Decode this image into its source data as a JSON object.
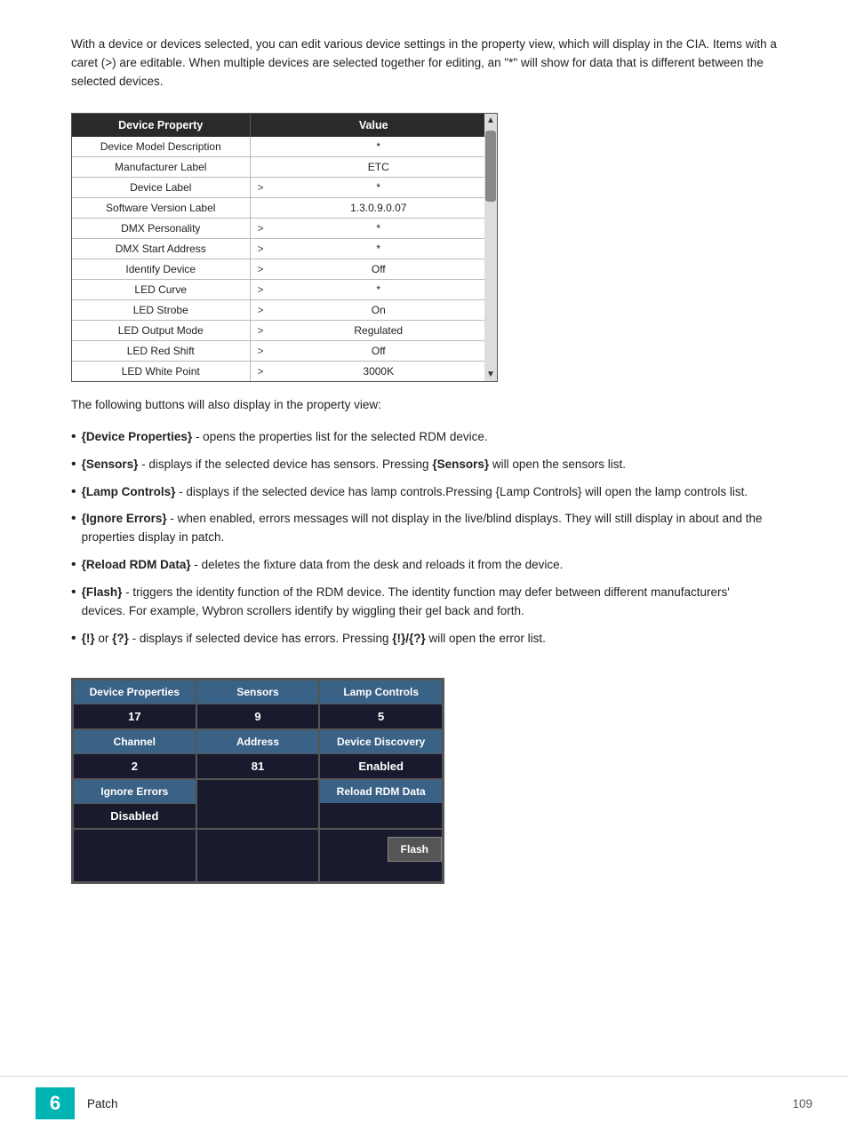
{
  "intro": {
    "text": "With a device or devices selected, you can edit various device settings in the property view, which will display in the CIA. Items with a caret (>) are editable. When multiple devices are selected together for editing, an \"*\" will show for data that is different between the selected devices."
  },
  "property_table": {
    "headers": [
      "Device Property",
      "Value"
    ],
    "rows": [
      {
        "property": "Device Model Description",
        "caret": "",
        "value": "*"
      },
      {
        "property": "Manufacturer Label",
        "caret": "",
        "value": "ETC"
      },
      {
        "property": "Device Label",
        "caret": ">",
        "value": "*"
      },
      {
        "property": "Software Version Label",
        "caret": "",
        "value": "1.3.0.9.0.07"
      },
      {
        "property": "DMX Personality",
        "caret": ">",
        "value": "*"
      },
      {
        "property": "DMX Start Address",
        "caret": ">",
        "value": "*"
      },
      {
        "property": "Identify Device",
        "caret": ">",
        "value": "Off"
      },
      {
        "property": "LED Curve",
        "caret": ">",
        "value": "*"
      },
      {
        "property": "LED Strobe",
        "caret": ">",
        "value": "On"
      },
      {
        "property": "LED Output Mode",
        "caret": ">",
        "value": "Regulated"
      },
      {
        "property": "LED Red Shift",
        "caret": ">",
        "value": "Off"
      },
      {
        "property": "LED White Point",
        "caret": ">",
        "value": "3000K"
      }
    ]
  },
  "bullets_intro": "The following buttons will also display in the property view:",
  "bullets": [
    {
      "key": "{Device Properties}",
      "text": " - opens the properties list for the selected RDM device."
    },
    {
      "key": "{Sensors}",
      "text": " - displays if the selected device has sensors. Pressing "
    },
    {
      "key2": "{Sensors}",
      "text2": " will open the sensors list.",
      "combined": true,
      "full": "{Sensors} - displays if the selected device has sensors. Pressing {Sensors} will open the sensors list."
    },
    {
      "key": "{Lamp Controls}",
      "text": " - displays if the selected device has lamp controls.Pressing {Lamp Controls} will open the lamp controls list.",
      "full": "{Lamp Controls} - displays if the selected device has lamp controls.Pressing {Lamp Controls} will open the lamp controls list."
    },
    {
      "key": "{Ignore Errors}",
      "text": " - when enabled, errors messages will not display in the live/blind displays. They will still display in about and the properties display in patch.",
      "full": "{Ignore Errors} - when enabled, errors messages will not display in the live/blind displays. They will still display in about and the properties display in patch."
    },
    {
      "key": "{Reload RDM Data}",
      "text": " - deletes the fixture data from the desk and reloads it from the device.",
      "full": "{Reload RDM Data} - deletes the fixture data from the desk and reloads it from the device."
    },
    {
      "key": "{Flash}",
      "text": " - triggers the identity function of the RDM device. The identity function may defer between different manufacturers' devices. For example, Wybron scrollers identify by wiggling their gel back and forth.",
      "full": "{Flash} - triggers the identity function of the RDM device. The identity function may defer between different manufacturers' devices. For example, Wybron scrollers identify by wiggling their gel back and forth."
    },
    {
      "key": "{!}",
      "text": " or ",
      "key2": "{?}",
      "text2": " - displays if selected device has errors. Pressing ",
      "key3": "{!}/{?}",
      "text3": " will open the error list.",
      "full": "{!} or {?} - displays if selected device has errors. Pressing {!}/{?} will open the error list."
    }
  ],
  "button_panel": {
    "row1": [
      {
        "label": "Device Properties",
        "value": "17"
      },
      {
        "label": "Sensors",
        "value": "9"
      },
      {
        "label": "Lamp Controls",
        "value": "5"
      }
    ],
    "row2": [
      {
        "label": "Channel",
        "value": "2"
      },
      {
        "label": "Address",
        "value": "81"
      },
      {
        "label": "Device Discovery",
        "value": "Enabled"
      }
    ],
    "row3_left": {
      "label": "Ignore Errors",
      "value": "Disabled"
    },
    "row3_right": {
      "label": "Reload RDM Data"
    },
    "flash": {
      "label": "Flash"
    }
  },
  "footer": {
    "page_number": "6",
    "section": "Patch",
    "page": "109"
  }
}
